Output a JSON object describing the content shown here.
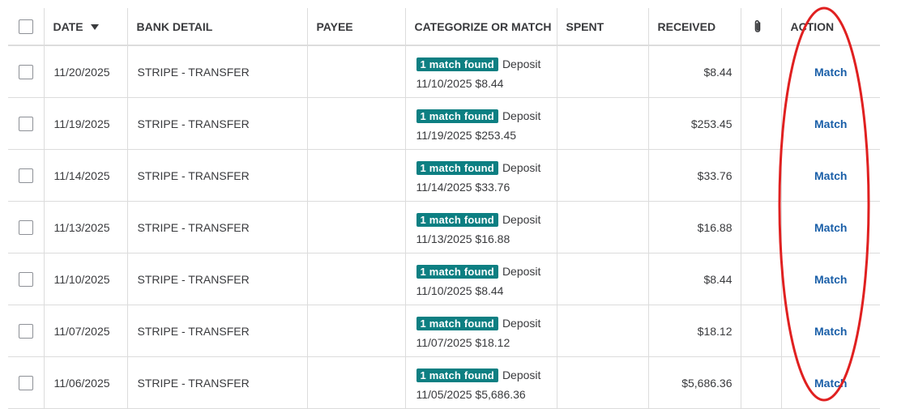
{
  "header": {
    "date": "DATE",
    "bank_detail": "BANK DETAIL",
    "payee": "PAYEE",
    "categorize": "CATEGORIZE OR MATCH",
    "spent": "SPENT",
    "received": "RECEIVED",
    "action": "ACTION"
  },
  "icons": {
    "sort": "sort-desc-icon",
    "attachment": "paperclip-icon"
  },
  "colors": {
    "badge": "#0d7f82",
    "link": "#1a5fa8",
    "annotation": "#e02020"
  },
  "rows": [
    {
      "date": "11/20/2025",
      "bank_detail": "STRIPE - TRANSFER",
      "payee": "",
      "badge": "1 match found",
      "match_type": "Deposit",
      "match_detail": "11/10/2025 $8.44",
      "spent": "",
      "received": "$8.44",
      "action": "Match"
    },
    {
      "date": "11/19/2025",
      "bank_detail": "STRIPE - TRANSFER",
      "payee": "",
      "badge": "1 match found",
      "match_type": "Deposit",
      "match_detail": "11/19/2025 $253.45",
      "spent": "",
      "received": "$253.45",
      "action": "Match"
    },
    {
      "date": "11/14/2025",
      "bank_detail": "STRIPE - TRANSFER",
      "payee": "",
      "badge": "1 match found",
      "match_type": "Deposit",
      "match_detail": "11/14/2025 $33.76",
      "spent": "",
      "received": "$33.76",
      "action": "Match"
    },
    {
      "date": "11/13/2025",
      "bank_detail": "STRIPE - TRANSFER",
      "payee": "",
      "badge": "1 match found",
      "match_type": "Deposit",
      "match_detail": "11/13/2025 $16.88",
      "spent": "",
      "received": "$16.88",
      "action": "Match"
    },
    {
      "date": "11/10/2025",
      "bank_detail": "STRIPE - TRANSFER",
      "payee": "",
      "badge": "1 match found",
      "match_type": "Deposit",
      "match_detail": "11/10/2025 $8.44",
      "spent": "",
      "received": "$8.44",
      "action": "Match"
    },
    {
      "date": "11/07/2025",
      "bank_detail": "STRIPE - TRANSFER",
      "payee": "",
      "badge": "1 match found",
      "match_type": "Deposit",
      "match_detail": "11/07/2025 $18.12",
      "spent": "",
      "received": "$18.12",
      "action": "Match"
    },
    {
      "date": "11/06/2025",
      "bank_detail": "STRIPE - TRANSFER",
      "payee": "",
      "badge": "1 match found",
      "match_type": "Deposit",
      "match_detail": "11/05/2025 $5,686.36",
      "spent": "",
      "received": "$5,686.36",
      "action": "Match"
    }
  ]
}
